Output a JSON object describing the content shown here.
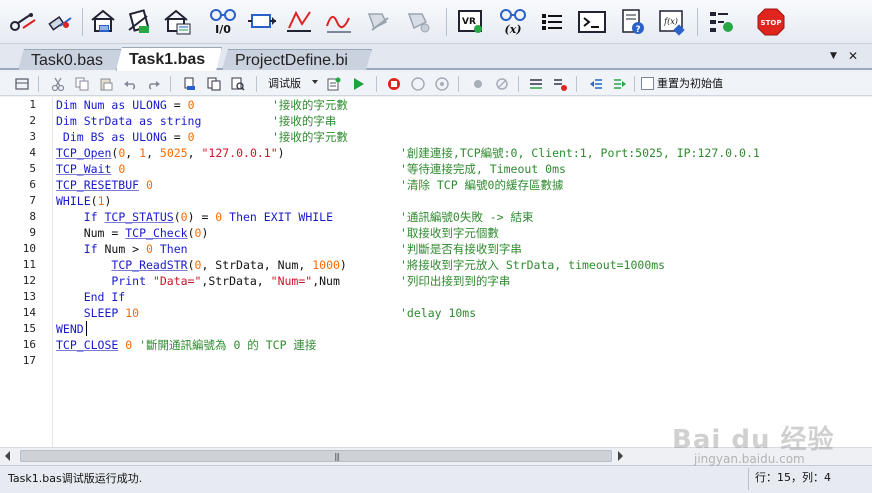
{
  "toolbar": {
    "icons": [
      "set-breakpoint-icon",
      "clear-breakpoint-icon",
      "download-program-icon",
      "download-ram-icon",
      "download-rom-icon",
      "io-monitor-icon",
      "axis-parameters-icon",
      "scope-icon",
      "oscilloscope-icon",
      "hide-icon",
      "build-icon",
      "variable-watch-icon",
      "expression-icon",
      "list-icon",
      "command-terminal-icon",
      "help-doc-icon",
      "function-doc-icon",
      "controller-settings-icon",
      "stop-icon"
    ],
    "io_label": "I/0",
    "expr_label": "(x)",
    "vr_label": "VR",
    "fd_label": "f(x)",
    "stop_label": "STOP"
  },
  "tabs": [
    {
      "label": "Task0.bas",
      "active": false
    },
    {
      "label": "Task1.bas",
      "active": true
    },
    {
      "label": "ProjectDefine.bi",
      "active": false
    }
  ],
  "tab_controls": {
    "dropdown": "▼",
    "close": "✕"
  },
  "editor_toolbar": {
    "build_mode": "调试版",
    "reset_label": "重置为初始值",
    "reset_checked": false
  },
  "code": {
    "line_numbers": [
      "1",
      "2",
      "3",
      "4",
      "5",
      "6",
      "7",
      "8",
      "9",
      "10",
      "11",
      "12",
      "13",
      "14",
      "15",
      "16",
      "17"
    ],
    "lines": [
      [
        {
          "t": "kw",
          "s": "Dim"
        },
        {
          "t": "kw",
          "s": " Num "
        },
        {
          "t": "kw",
          "s": "as"
        },
        {
          "t": "kw",
          "s": " ULONG "
        },
        {
          "t": "plain",
          "s": "= "
        },
        {
          "t": "num",
          "s": "0"
        }
      ],
      [
        {
          "t": "kw",
          "s": "Dim"
        },
        {
          "t": "kw",
          "s": " StrData "
        },
        {
          "t": "kw",
          "s": "as string"
        }
      ],
      [
        {
          "t": "kw",
          "s": " Dim"
        },
        {
          "t": "kw",
          "s": " BS "
        },
        {
          "t": "kw",
          "s": "as"
        },
        {
          "t": "kw",
          "s": " ULONG "
        },
        {
          "t": "plain",
          "s": "= "
        },
        {
          "t": "num",
          "s": "0"
        }
      ],
      [
        {
          "t": "fn",
          "s": "TCP_Open"
        },
        {
          "t": "plain",
          "s": "("
        },
        {
          "t": "num",
          "s": "0"
        },
        {
          "t": "plain",
          "s": ", "
        },
        {
          "t": "num",
          "s": "1"
        },
        {
          "t": "plain",
          "s": ", "
        },
        {
          "t": "num",
          "s": "5025"
        },
        {
          "t": "plain",
          "s": ", "
        },
        {
          "t": "str",
          "s": "\"127.0.0.1\""
        },
        {
          "t": "plain",
          "s": ")"
        }
      ],
      [
        {
          "t": "fn",
          "s": "TCP_Wait"
        },
        {
          "t": "plain",
          "s": " "
        },
        {
          "t": "num",
          "s": "0"
        }
      ],
      [
        {
          "t": "fn",
          "s": "TCP_RESETBUF"
        },
        {
          "t": "plain",
          "s": " "
        },
        {
          "t": "num",
          "s": "0"
        }
      ],
      [
        {
          "t": "kw",
          "s": "WHILE"
        },
        {
          "t": "plain",
          "s": "("
        },
        {
          "t": "num",
          "s": "1"
        },
        {
          "t": "plain",
          "s": ")"
        }
      ],
      [
        {
          "t": "kw",
          "s": "    If "
        },
        {
          "t": "fn",
          "s": "TCP_STATUS"
        },
        {
          "t": "plain",
          "s": "("
        },
        {
          "t": "num",
          "s": "0"
        },
        {
          "t": "plain",
          "s": ") = "
        },
        {
          "t": "num",
          "s": "0"
        },
        {
          "t": "kw",
          "s": " Then EXIT WHILE"
        }
      ],
      [
        {
          "t": "plain",
          "s": "    Num = "
        },
        {
          "t": "fn",
          "s": "TCP_Check"
        },
        {
          "t": "plain",
          "s": "("
        },
        {
          "t": "num",
          "s": "0"
        },
        {
          "t": "plain",
          "s": ")"
        }
      ],
      [
        {
          "t": "kw",
          "s": "    If"
        },
        {
          "t": "plain",
          "s": " Num > "
        },
        {
          "t": "num",
          "s": "0"
        },
        {
          "t": "kw",
          "s": " Then"
        }
      ],
      [
        {
          "t": "plain",
          "s": "        "
        },
        {
          "t": "fn",
          "s": "TCP_ReadSTR"
        },
        {
          "t": "plain",
          "s": "("
        },
        {
          "t": "num",
          "s": "0"
        },
        {
          "t": "plain",
          "s": ", StrData, Num, "
        },
        {
          "t": "num",
          "s": "1000"
        },
        {
          "t": "plain",
          "s": ")"
        }
      ],
      [
        {
          "t": "kw",
          "s": "        Print "
        },
        {
          "t": "str",
          "s": "\"Data=\""
        },
        {
          "t": "plain",
          "s": ",StrData, "
        },
        {
          "t": "str",
          "s": "\"Num=\""
        },
        {
          "t": "plain",
          "s": ",Num"
        }
      ],
      [
        {
          "t": "kw",
          "s": "    End If"
        }
      ],
      [
        {
          "t": "kw",
          "s": "    SLEEP "
        },
        {
          "t": "num",
          "s": "10"
        }
      ],
      [
        {
          "t": "kw",
          "s": "WEND"
        }
      ],
      [
        {
          "t": "fn",
          "s": "TCP_CLOSE"
        },
        {
          "t": "plain",
          "s": " "
        },
        {
          "t": "num",
          "s": "0"
        },
        {
          "t": "comment",
          "s": " '斷開通訊編號為 0 的 TCP 連接"
        }
      ],
      []
    ],
    "comments": [
      {
        "line": 1,
        "text": "'接收的字元數"
      },
      {
        "line": 2,
        "text": "'接收的字串"
      },
      {
        "line": 3,
        "text": "'接收的字元數"
      },
      {
        "line": 4,
        "text": "'創建連接,TCP編號:0, Client:1, Port:5025, IP:127.0.0.1"
      },
      {
        "line": 5,
        "text": "'等待連接完成, Timeout 0ms"
      },
      {
        "line": 6,
        "text": "'清除 TCP 編號0的緩存區數據"
      },
      {
        "line": 8,
        "text": "'通訊編號0失敗 -> 結束"
      },
      {
        "line": 9,
        "text": "'取接收到字元個數"
      },
      {
        "line": 10,
        "text": "'判斷是否有接收到字串"
      },
      {
        "line": 11,
        "text": "'將接收到字元放入 StrData, timeout=1000ms"
      },
      {
        "line": 12,
        "text": "'列印出接到到的字串"
      },
      {
        "line": 14,
        "text": "'delay 10ms"
      }
    ]
  },
  "status": {
    "message": "Task1.bas调试版运行成功.",
    "position": "行：15，列：4"
  },
  "watermark": {
    "logo": "Bai du 经验",
    "url": "jingyan.baidu.com"
  }
}
